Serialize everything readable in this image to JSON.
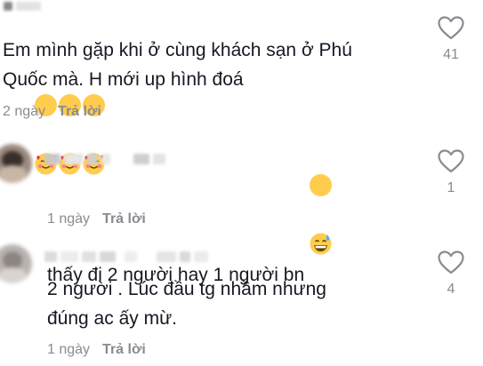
{
  "comments": [
    {
      "text": "Em mình gặp khi ở cùng khách sạn ở Phú\nQuốc mà. H mới up hình đoá",
      "emojis": [
        "smiling-face-with-hearts",
        "smiling-face-with-hearts",
        "smiling-face-with-hearts"
      ],
      "time": "2 ngày",
      "reply_label": "Trả lời",
      "likes": "41"
    },
    {
      "text": "thấy đi 2 người hay 1 người bn",
      "emojis": [
        "grinning-face-with-sweat"
      ],
      "time": "1 ngày",
      "reply_label": "Trả lời",
      "likes": "1"
    },
    {
      "text": "2 người . Lúc đầu tg nhầm nhưng\nđúng ac ấy mừ.",
      "emojis": [],
      "time": "1 ngày",
      "reply_label": "Trả lời",
      "likes": "4"
    }
  ],
  "icons": {
    "like": "heart-outline-icon"
  },
  "colors": {
    "text": "#161823",
    "muted": "#8a8b91",
    "emoji_face": "#ffcc4d"
  }
}
